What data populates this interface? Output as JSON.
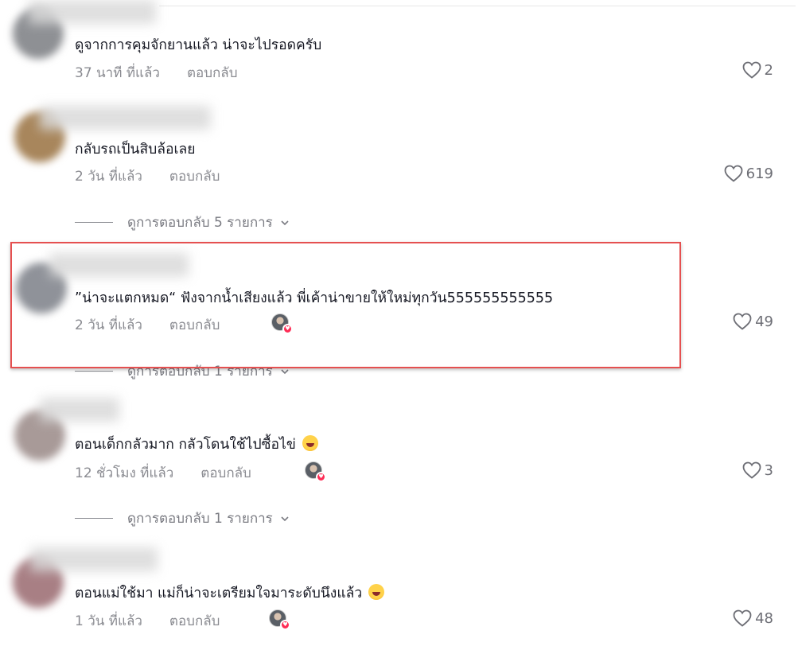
{
  "comments": [
    {
      "text": "ดูจากการคุมจักยานแล้ว น่าจะไปรอดครับ",
      "time": "37 นาที ที่แล้ว",
      "reply": "ตอบกลับ",
      "likes": "2",
      "creator_liked": false
    },
    {
      "text": "กลับรถเป็นสิบล้อเลย",
      "time": "2 วัน ที่แล้ว",
      "reply": "ตอบกลับ",
      "likes": "619",
      "creator_liked": false,
      "view_replies": "ดูการตอบกลับ 5 รายการ"
    },
    {
      "text": "”น่าจะแตกหมด“ ฟังจากน้ำเสียงแล้ว พี่เค้าน่าขายให้ใหม่ทุกวัน555555555555",
      "time": "2 วัน ที่แล้ว",
      "reply": "ตอบกลับ",
      "likes": "49",
      "creator_liked": true,
      "view_replies": "ดูการตอบกลับ 1 รายการ"
    },
    {
      "text": "ตอนเด็กกลัวมาก กลัวโดนใช้ไปซื้อไข่",
      "time": "12 ชั่วโมง ที่แล้ว",
      "reply": "ตอบกลับ",
      "likes": "3",
      "creator_liked": true,
      "view_replies": "ดูการตอบกลับ 1 รายการ"
    },
    {
      "text": "ตอนแม่ใช้มา แม่ก็น่าจะเตรียมใจมาระดับนึงแล้ว",
      "time": "1 วัน ที่แล้ว",
      "reply": "ตอบกลับ",
      "likes": "48",
      "creator_liked": true
    }
  ],
  "icons": {
    "like": "heart-outline-icon",
    "expand": "chevron-down-icon",
    "emoji": "laughing-emoji-icon"
  },
  "colors": {
    "highlight_border": "#e55050",
    "like_badge": "#fe2c55",
    "secondary_text": "#8a8b91"
  }
}
